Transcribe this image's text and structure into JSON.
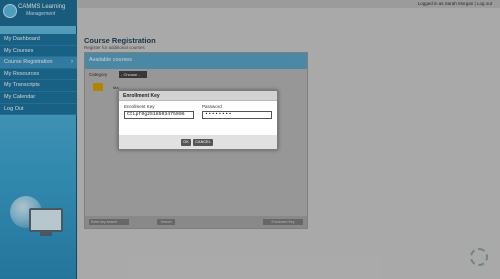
{
  "app": {
    "logo_line1": "CAMMS Learning",
    "logo_line2": "Management"
  },
  "topbar": {
    "user_text": "Logged in as Sarah Morgan | Log out"
  },
  "sidebar": {
    "items": [
      {
        "label": "My Dashboard"
      },
      {
        "label": "My Courses"
      },
      {
        "label": "Course Registration",
        "active": true
      },
      {
        "label": "My Resources"
      },
      {
        "label": "My Transcripts"
      },
      {
        "label": "My Calendar"
      },
      {
        "label": "Log Out"
      }
    ]
  },
  "page": {
    "title": "Course Registration",
    "subtitle": "Register for additional courses"
  },
  "panel": {
    "header": "Available courses",
    "filter_label": "Category",
    "filter_value": "- Choose -",
    "row_text": "Ma",
    "search_placeholder": "Enter key search",
    "search_button": "Search",
    "footer_button": "Enrolment Key"
  },
  "modal": {
    "title": "Enrollment Key",
    "enrollment_label": "Enrollment Key",
    "enrollment_value": "CtLpf0g2518503475006",
    "password_label": "Password",
    "password_value": "••••••••",
    "ok_label": "OK",
    "cancel_label": "CANCEL"
  },
  "colors": {
    "sidebar_accent": "#1e77a3",
    "panel_header": "#5ba6c8",
    "page_title": "#1d3f57"
  }
}
